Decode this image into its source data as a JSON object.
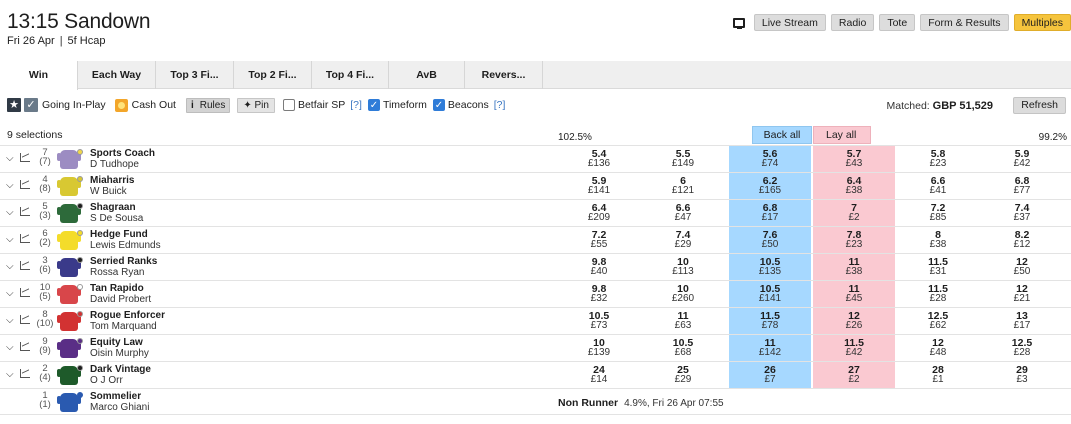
{
  "race": {
    "title": "13:15 Sandown",
    "date": "Fri 26 Apr",
    "type": "5f Hcap"
  },
  "top_buttons": [
    "Live Stream",
    "Radio",
    "Tote",
    "Form & Results",
    "Multiples"
  ],
  "tabs": [
    "Win",
    "Each Way",
    "Top 3 Fi...",
    "Top 2 Fi...",
    "Top 4 Fi...",
    "AvB",
    "Revers..."
  ],
  "toolbar": {
    "star": "★",
    "in_play": "Going In-Play",
    "cash_out": "Cash Out",
    "rules_i": "i",
    "rules": "Rules",
    "pin": "Pin",
    "betfair_sp": "Betfair SP",
    "help1": "[?]",
    "timeform": "Timeform",
    "beacons": "Beacons",
    "help2": "[?]"
  },
  "matched": {
    "label": "Matched:",
    "value": "GBP 51,529"
  },
  "refresh": "Refresh",
  "market": {
    "selections": "9 selections",
    "back_pct": "102.5%",
    "lay_pct": "99.2%",
    "back_all": "Back all",
    "lay_all": "Lay all"
  },
  "runners": [
    {
      "num": "7",
      "draw": "(7)",
      "horse": "Sports Coach",
      "jockey": "D Tudhope",
      "silk": "#9c8cc2",
      "cap": "#f0d64a",
      "prices": [
        [
          "5.4",
          "£136"
        ],
        [
          "5.5",
          "£149"
        ],
        [
          "5.6",
          "£74"
        ],
        [
          "5.7",
          "£43"
        ],
        [
          "5.8",
          "£23"
        ],
        [
          "5.9",
          "£42"
        ]
      ]
    },
    {
      "num": "4",
      "draw": "(8)",
      "horse": "Miaharris",
      "jockey": "W Buick",
      "silk": "#d8c832",
      "cap": "#d8c832",
      "prices": [
        [
          "5.9",
          "£141"
        ],
        [
          "6",
          "£121"
        ],
        [
          "6.2",
          "£165"
        ],
        [
          "6.4",
          "£38"
        ],
        [
          "6.6",
          "£41"
        ],
        [
          "6.8",
          "£77"
        ]
      ]
    },
    {
      "num": "5",
      "draw": "(3)",
      "horse": "Shagraan",
      "jockey": "S De Sousa",
      "silk": "#2d6a3a",
      "cap": "#1e1e1e",
      "prices": [
        [
          "6.4",
          "£209"
        ],
        [
          "6.6",
          "£47"
        ],
        [
          "6.8",
          "£17"
        ],
        [
          "7",
          "£2"
        ],
        [
          "7.2",
          "£85"
        ],
        [
          "7.4",
          "£37"
        ]
      ]
    },
    {
      "num": "6",
      "draw": "(2)",
      "horse": "Hedge Fund",
      "jockey": "Lewis Edmunds",
      "silk": "#f4dc2a",
      "cap": "#f4dc2a",
      "prices": [
        [
          "7.2",
          "£55"
        ],
        [
          "7.4",
          "£29"
        ],
        [
          "7.6",
          "£50"
        ],
        [
          "7.8",
          "£23"
        ],
        [
          "8",
          "£38"
        ],
        [
          "8.2",
          "£12"
        ]
      ]
    },
    {
      "num": "3",
      "draw": "(6)",
      "horse": "Serried Ranks",
      "jockey": "Rossa Ryan",
      "silk": "#3a3a8a",
      "cap": "#1e1e1e",
      "prices": [
        [
          "9.8",
          "£40"
        ],
        [
          "10",
          "£113"
        ],
        [
          "10.5",
          "£135"
        ],
        [
          "11",
          "£38"
        ],
        [
          "11.5",
          "£31"
        ],
        [
          "12",
          "£50"
        ]
      ]
    },
    {
      "num": "10",
      "draw": "(5)",
      "horse": "Tan Rapido",
      "jockey": "David Probert",
      "silk": "#d8464a",
      "cap": "#ffffff",
      "prices": [
        [
          "9.8",
          "£32"
        ],
        [
          "10",
          "£260"
        ],
        [
          "10.5",
          "£141"
        ],
        [
          "11",
          "£45"
        ],
        [
          "11.5",
          "£28"
        ],
        [
          "12",
          "£21"
        ]
      ]
    },
    {
      "num": "8",
      "draw": "(10)",
      "horse": "Rogue Enforcer",
      "jockey": "Tom Marquand",
      "silk": "#d23232",
      "cap": "#d23232",
      "prices": [
        [
          "10.5",
          "£73"
        ],
        [
          "11",
          "£63"
        ],
        [
          "11.5",
          "£78"
        ],
        [
          "12",
          "£26"
        ],
        [
          "12.5",
          "£62"
        ],
        [
          "13",
          "£17"
        ]
      ]
    },
    {
      "num": "9",
      "draw": "(9)",
      "horse": "Equity Law",
      "jockey": "Oisin Murphy",
      "silk": "#5a2e86",
      "cap": "#5a2e86",
      "prices": [
        [
          "10",
          "£139"
        ],
        [
          "10.5",
          "£68"
        ],
        [
          "11",
          "£142"
        ],
        [
          "11.5",
          "£42"
        ],
        [
          "12",
          "£48"
        ],
        [
          "12.5",
          "£28"
        ]
      ]
    },
    {
      "num": "2",
      "draw": "(4)",
      "horse": "Dark Vintage",
      "jockey": "O J Orr",
      "silk": "#1e5a2a",
      "cap": "#1e1e1e",
      "prices": [
        [
          "24",
          "£14"
        ],
        [
          "25",
          "£29"
        ],
        [
          "26",
          "£7"
        ],
        [
          "27",
          "£2"
        ],
        [
          "28",
          "£1"
        ],
        [
          "29",
          "£3"
        ]
      ]
    }
  ],
  "non_runner": {
    "num": "1",
    "draw": "(1)",
    "horse": "Sommelier",
    "jockey": "Marco Ghiani",
    "silk": "#2a5ab0",
    "cap": "#2a5ab0",
    "label": "Non Runner",
    "info": "4.9%, Fri 26 Apr 07:55"
  }
}
